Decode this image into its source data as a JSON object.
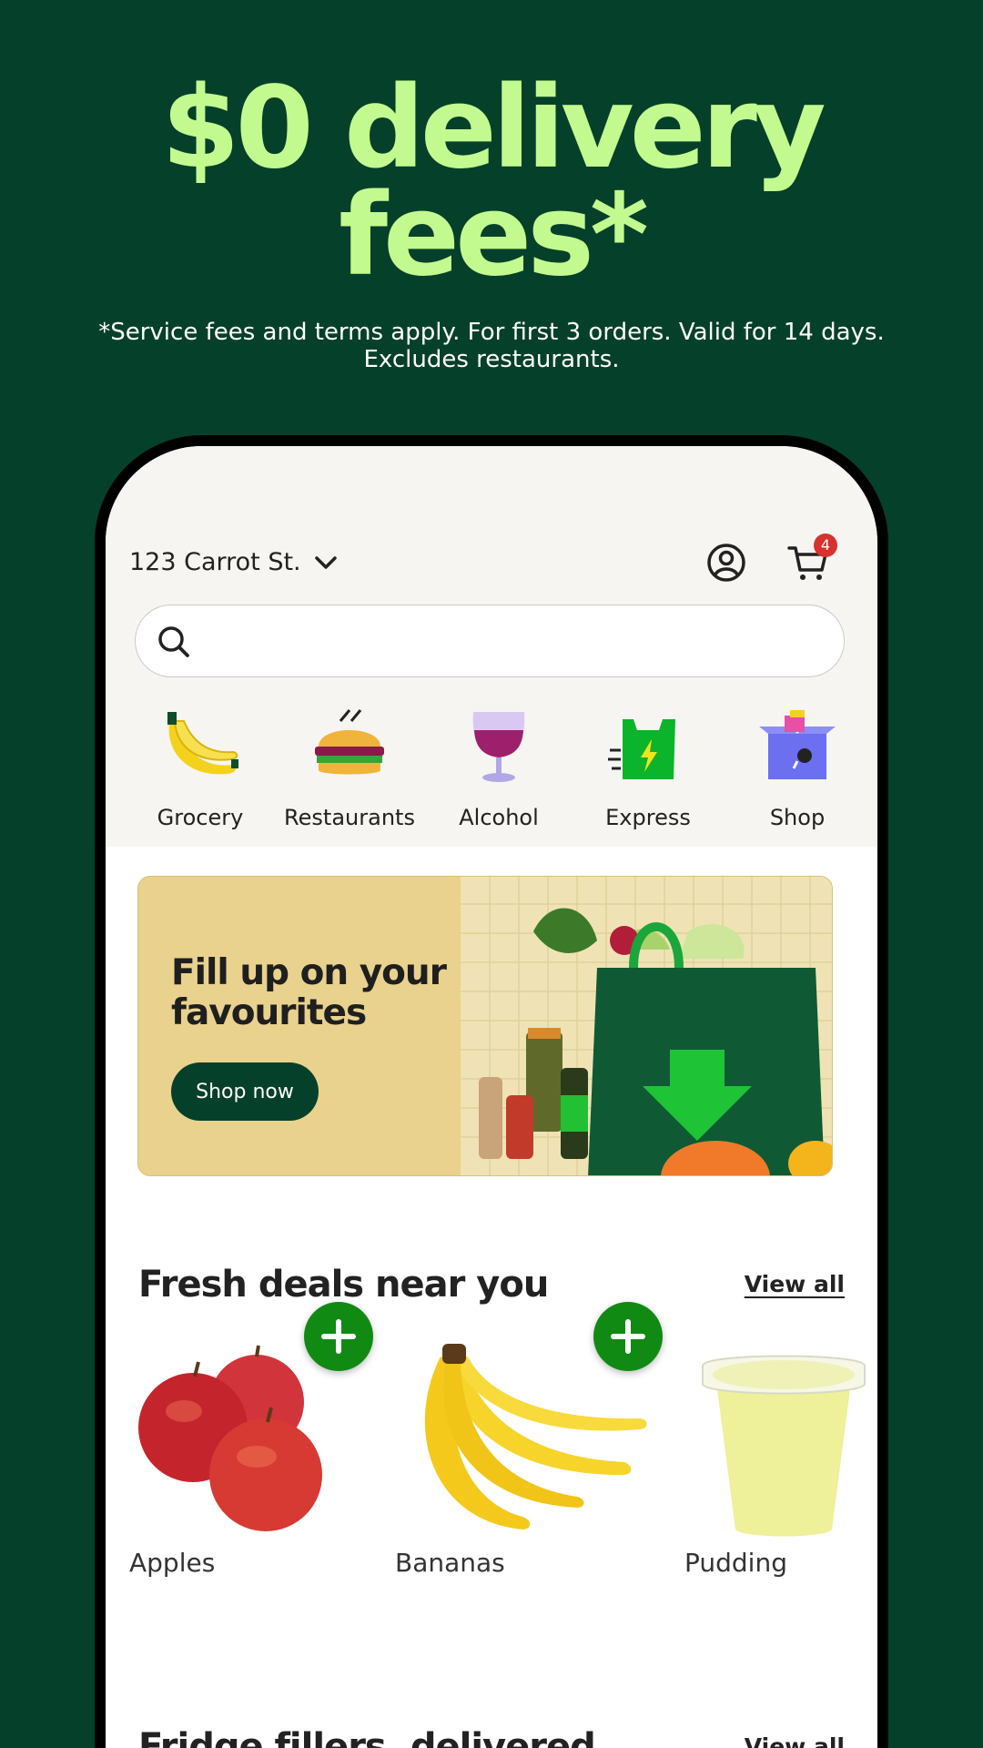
{
  "hero": {
    "title_line1": "$0 delivery",
    "title_line2": "fees*",
    "subtitle_line1": "*Service fees and terms apply. For first 3 orders. Valid for 14 days.",
    "subtitle_line2": "Excludes restaurants."
  },
  "header": {
    "address": "123 Carrot St.",
    "cart_count": "4"
  },
  "search": {
    "placeholder": ""
  },
  "categories": [
    {
      "label": "Grocery",
      "icon": "banana-icon"
    },
    {
      "label": "Restaurants",
      "icon": "burger-icon"
    },
    {
      "label": "Alcohol",
      "icon": "wine-glass-icon"
    },
    {
      "label": "Express",
      "icon": "express-bag-icon"
    },
    {
      "label": "Shop",
      "icon": "gift-box-icon"
    }
  ],
  "banner": {
    "title": "Fill up on your favourites",
    "button": "Shop now"
  },
  "sections": {
    "fresh_deals": {
      "title": "Fresh deals near you",
      "view_all": "View all"
    },
    "fridge_fillers": {
      "title": "Fridge fillers, delivered",
      "view_all": "View all"
    }
  },
  "products": [
    {
      "label": "Apples"
    },
    {
      "label": "Bananas"
    },
    {
      "label": "Pudding"
    }
  ],
  "colors": {
    "background": "#05402a",
    "accent": "#c2fa8f",
    "add_button": "#118a14",
    "badge": "#d6322f",
    "banner": "#e9d28e"
  }
}
